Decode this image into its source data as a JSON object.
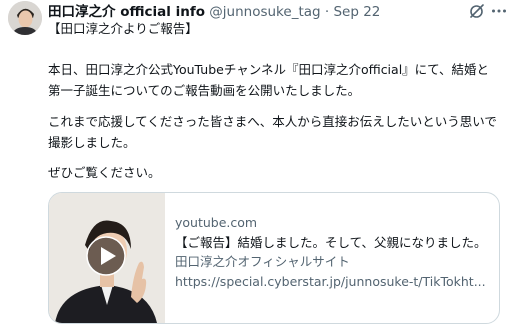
{
  "tweet": {
    "display_name": "田口淳之介 official info",
    "handle": "@junnosuke_tag",
    "separator": "·",
    "time": "Sep 22",
    "icons": {
      "header_action": "grok-icon",
      "more": "more-icon",
      "avatar": "avatar-photo",
      "play": "play-icon"
    },
    "paragraphs": [
      "【田口淳之介よりご報告】",
      "本日、田口淳之介公式YouTubeチャンネル『田口淳之介official』にて、結婚と第一子誕生についてのご報告動画を公開いたしました。",
      "これまで応援してくださった皆さまへ、本人から直接お伝えしたいという思いで撮影しました。",
      "ぜひご覧ください。"
    ],
    "card": {
      "domain": "youtube.com",
      "title": "【ご報告】結婚しました。そして、父親になりました。",
      "site": "田口淳之介オフィシャルサイト",
      "url": "https://special.cyberstar.jp/junnosuke-t/TikTokht..."
    }
  },
  "colors": {
    "text": "#0f1419",
    "secondary": "#536471",
    "border": "#cfd9de",
    "background": "#ffffff"
  }
}
